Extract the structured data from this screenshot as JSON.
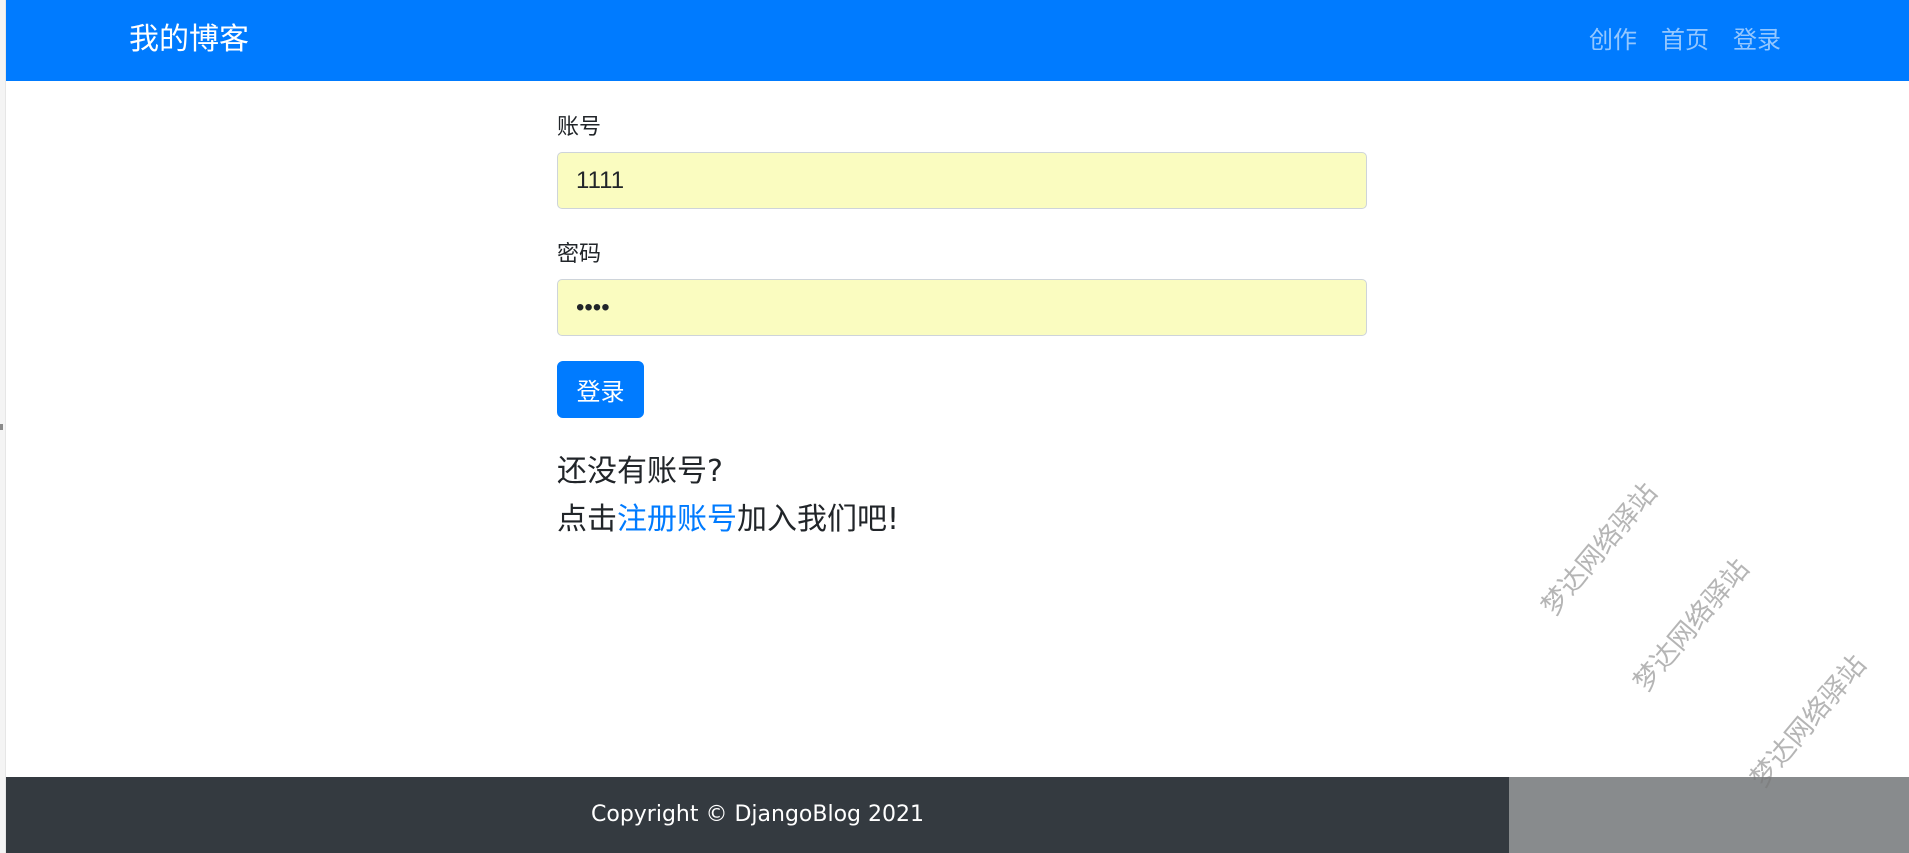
{
  "navbar": {
    "brand": "我的博客",
    "links": [
      "创作",
      "首页",
      "登录"
    ],
    "background": "#007bff"
  },
  "login_form": {
    "username_label": "账号",
    "username_value": "1111",
    "password_label": "密码",
    "password_value": "••••",
    "submit_label": "登录"
  },
  "signup_prompt": {
    "line1": "还没有账号?",
    "prefix": "点击",
    "link_text": "注册账号",
    "suffix": "加入我们吧!"
  },
  "footer": {
    "text": "Copyright © DjangoBlog 2021",
    "background": "#343a40"
  },
  "watermark": {
    "text": "梦达网络驿站"
  }
}
